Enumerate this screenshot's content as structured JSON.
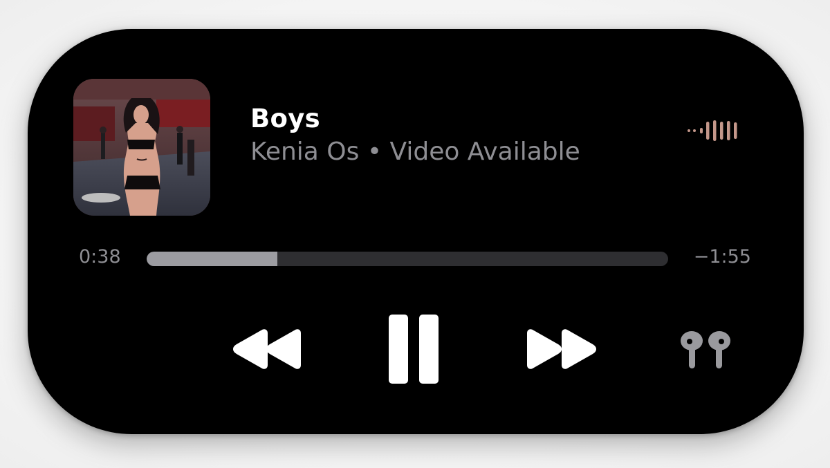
{
  "now_playing": {
    "title": "Boys",
    "subtitle": "Kenia Os • Video Available",
    "elapsed": "0:38",
    "remaining": "−1:55",
    "progress": 0.25
  },
  "icons": {
    "waveform": "audio-waveform-icon",
    "rewind": "rewind-icon",
    "pause": "pause-icon",
    "forward": "fast-forward-icon",
    "output": "airpods-icon"
  },
  "colors": {
    "background": "#000000",
    "title": "#ffffff",
    "secondary_text": "#8e8e93",
    "progress_fill": "#9c9ca1",
    "progress_track": "#2e2e31",
    "waveform": "#c4978a"
  }
}
